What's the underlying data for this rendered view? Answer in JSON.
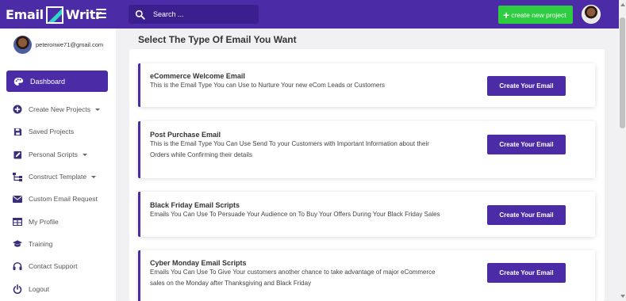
{
  "brand": {
    "word1": "Email",
    "word2": "Writr",
    "accent_color": "#4b2ba6",
    "logo_stripe_color": "#2fd6c8"
  },
  "header": {
    "search_placeholder": "Search ...",
    "create_label": "create new project",
    "create_color": "#2ecc40"
  },
  "user": {
    "email": "peteronwe71@gmail.com"
  },
  "sidebar": {
    "dashboard": {
      "label": "Dashboard",
      "icon": "palette-icon"
    },
    "items": [
      {
        "label": "Create New Projects",
        "icon": "plus-circle-icon",
        "caret": true
      },
      {
        "label": "Saved Projects",
        "icon": "save-icon",
        "caret": false
      },
      {
        "label": "Personal Scripts",
        "icon": "pencil-square-icon",
        "caret": true
      },
      {
        "label": "Construct Template",
        "icon": "sitemap-icon",
        "caret": true
      },
      {
        "label": "Custom Email Request",
        "icon": "envelope-icon",
        "caret": false
      },
      {
        "label": "My Profile",
        "icon": "table-icon",
        "caret": false
      },
      {
        "label": "Training",
        "icon": "graduation-cap-icon",
        "caret": false
      },
      {
        "label": "Contact Support",
        "icon": "headset-icon",
        "caret": false
      },
      {
        "label": "Logout",
        "icon": "power-icon",
        "caret": false
      }
    ]
  },
  "main": {
    "title": "Select The Type Of Email You Want",
    "cards": [
      {
        "title": "eCommerce Welcome Email",
        "desc_lines": [
          "This is the Email Type You can Use to Nurture Your new eCom Leads or Customers"
        ],
        "button": "Create Your Email"
      },
      {
        "title": "Post Purchase Email",
        "desc_lines": [
          "This is the Email Type You Can Use Send To your Customers with Important Information about their",
          "Orders while Confirming their details"
        ],
        "button": "Create Your Email"
      },
      {
        "title": "Black Friday Email Scripts",
        "desc_lines": [
          "Emails You Can Use To Persuade Your Audience on To Buy Your Offers During Your Black Friday Sales"
        ],
        "button": "Create Your Email"
      },
      {
        "title": "Cyber Monday Email Scripts",
        "desc_lines": [
          "Emails You Can Use To Give Your customers another chance to take advantage of major eCommerce",
          "sales on the Monday after Thanksgiving and Black Friday"
        ],
        "button": "Create Your Email"
      }
    ]
  }
}
